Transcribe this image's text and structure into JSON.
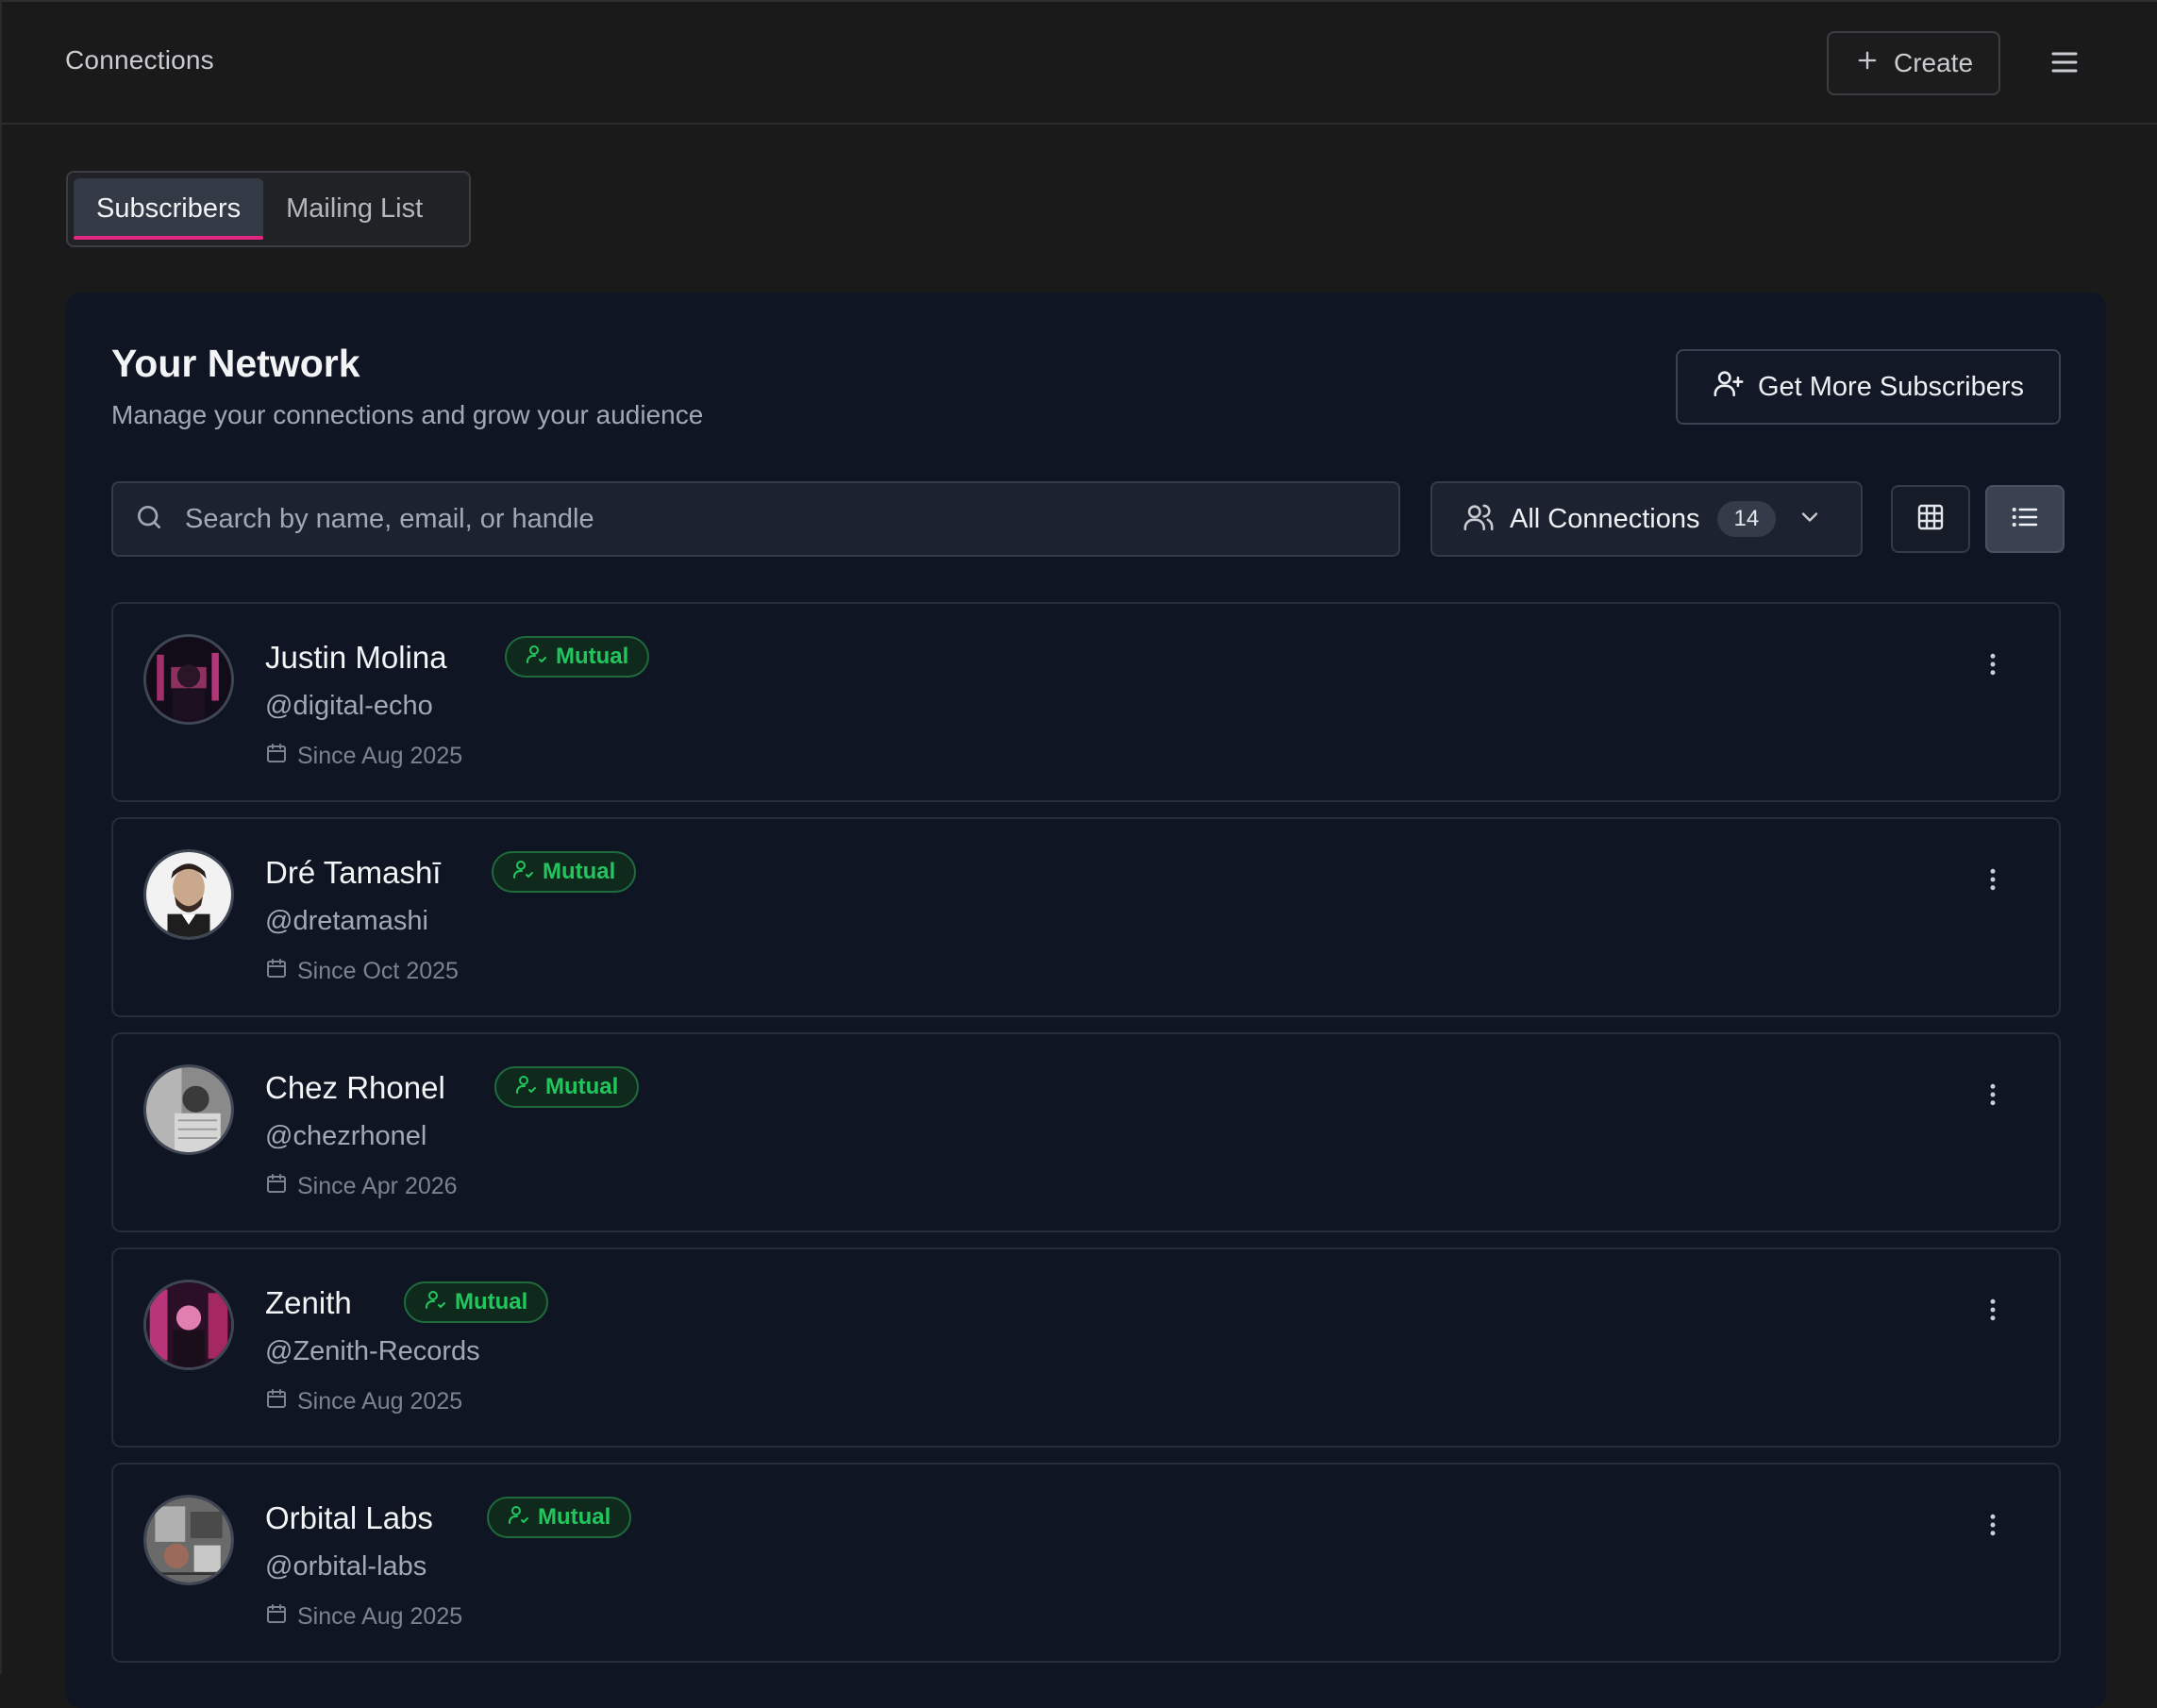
{
  "header": {
    "title": "Connections",
    "create_label": "Create"
  },
  "tabs": [
    {
      "label": "Subscribers",
      "active": true
    },
    {
      "label": "Mailing List",
      "active": false
    }
  ],
  "panel": {
    "title": "Your Network",
    "subtitle": "Manage your connections and grow your audience",
    "cta_label": "Get More Subscribers"
  },
  "search": {
    "placeholder": "Search by name, email, or handle",
    "value": ""
  },
  "filter": {
    "label": "All Connections",
    "count": "14"
  },
  "view": {
    "selected": "list"
  },
  "colors": {
    "accent": "#e3267e",
    "mutual_green": "#22c55e",
    "panel_bg": "#0f1522",
    "page_bg": "#1a1a1a"
  },
  "connections": [
    {
      "name": "Justin Molina",
      "badge": "Mutual",
      "handle": "@digital-echo",
      "since": "Since Aug 2025"
    },
    {
      "name": "Dré Tamashī",
      "badge": "Mutual",
      "handle": "@dretamashi",
      "since": "Since Oct 2025"
    },
    {
      "name": "Chez Rhonel",
      "badge": "Mutual",
      "handle": "@chezrhonel",
      "since": "Since Apr 2026"
    },
    {
      "name": "Zenith",
      "badge": "Mutual",
      "handle": "@Zenith-Records",
      "since": "Since Aug 2025"
    },
    {
      "name": "Orbital Labs",
      "badge": "Mutual",
      "handle": "@orbital-labs",
      "since": "Since Aug 2025"
    }
  ]
}
